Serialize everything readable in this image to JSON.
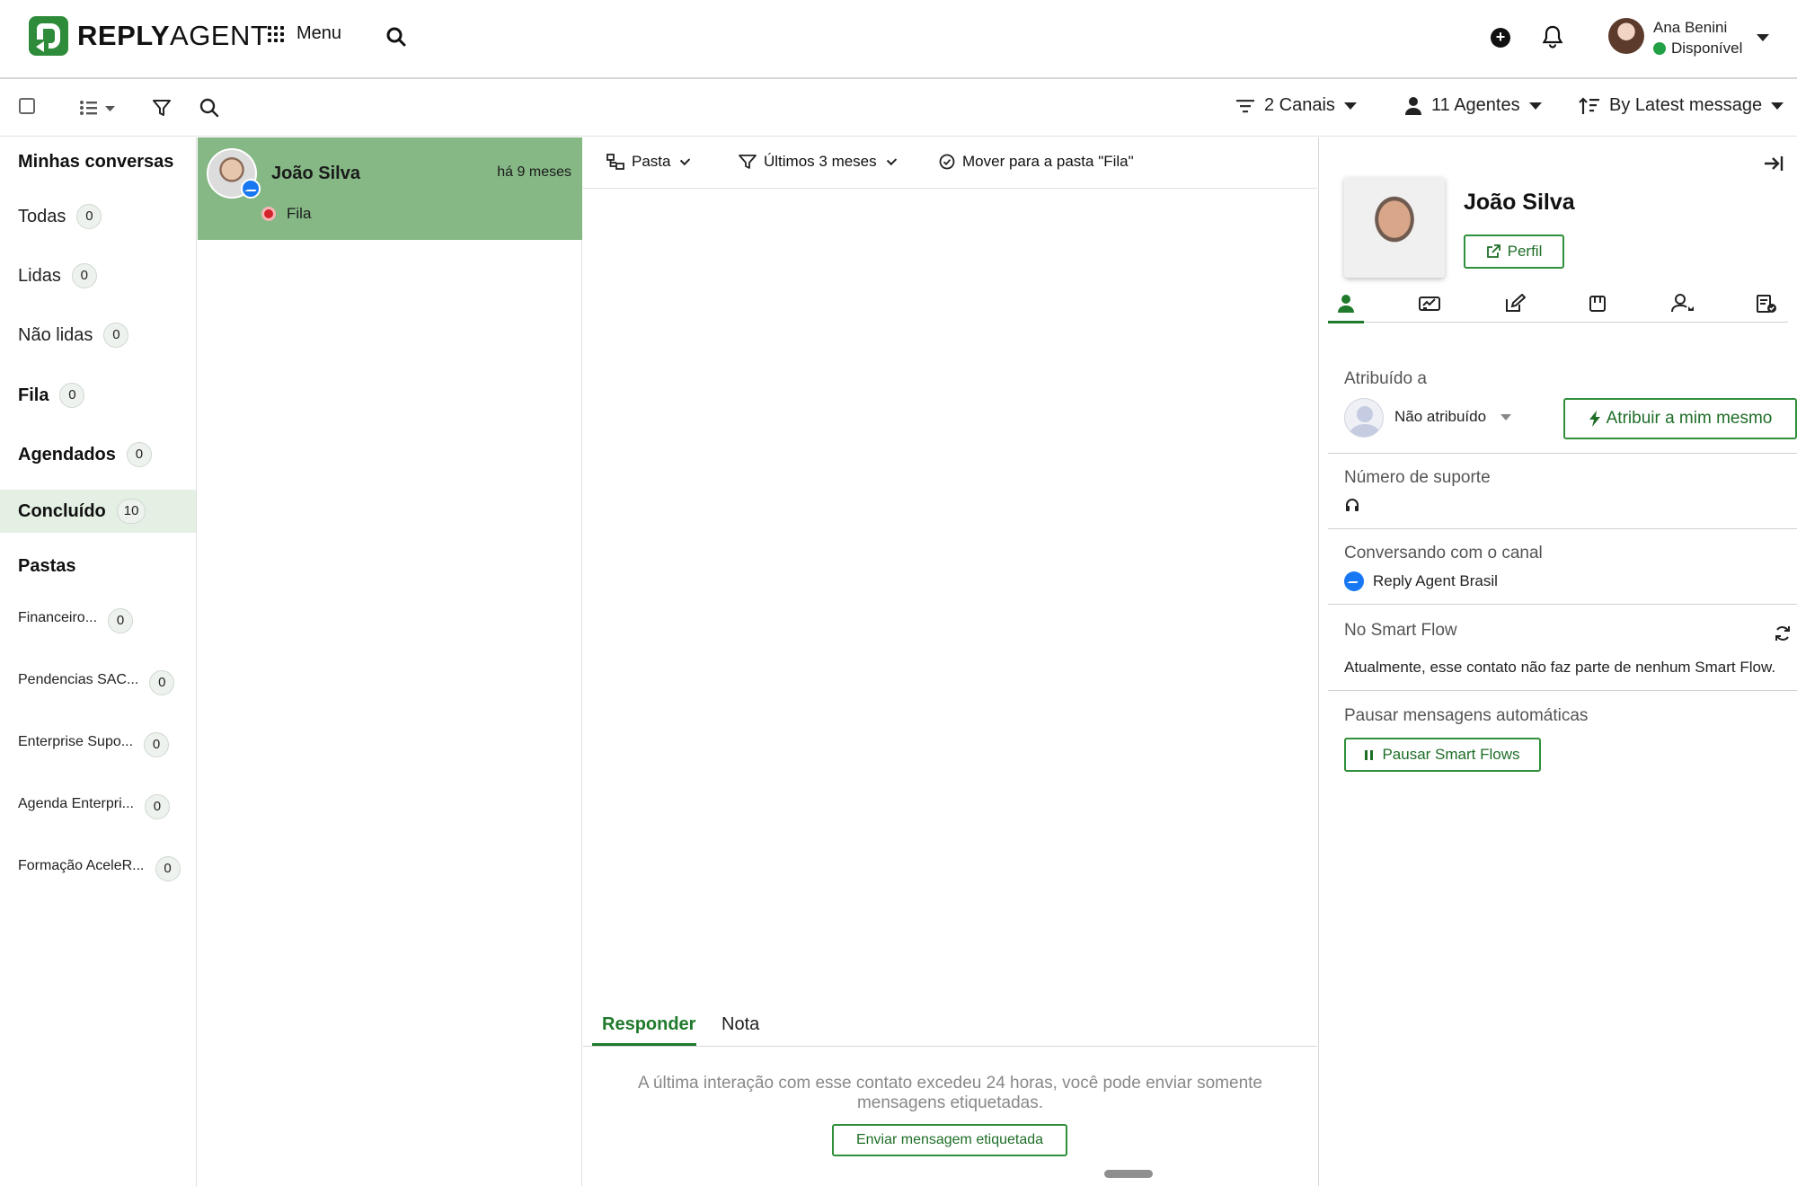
{
  "brand": {
    "name_bold": "REPLY",
    "name_light": "AGENT"
  },
  "header": {
    "menu_label": "Menu",
    "user_name": "Ana Benini",
    "user_status": "Disponível"
  },
  "toolbar": {
    "channels": "2 Canais",
    "agents": "11 Agentes",
    "sort": "By Latest message"
  },
  "nav": {
    "my_conversations": "Minhas conversas",
    "items": [
      {
        "label": "Todas",
        "count": "0"
      },
      {
        "label": "Lidas",
        "count": "0"
      },
      {
        "label": "Não lidas",
        "count": "0"
      },
      {
        "label": "Fila",
        "count": "0"
      },
      {
        "label": "Agendados",
        "count": "0"
      },
      {
        "label": "Concluído",
        "count": "10"
      }
    ],
    "folders_title": "Pastas",
    "folders": [
      {
        "label": "Financeiro...",
        "count": "0"
      },
      {
        "label": "Pendencias SAC...",
        "count": "0"
      },
      {
        "label": "Enterprise Supo...",
        "count": "0"
      },
      {
        "label": "Agenda Enterpri...",
        "count": "0"
      },
      {
        "label": "Formação AceleR...",
        "count": "0"
      }
    ]
  },
  "conversation": {
    "name": "João Silva",
    "time": "há 9 meses",
    "status": "Fila"
  },
  "chat": {
    "folder_label": "Pasta",
    "period_label": "Últimos 3 meses",
    "move_label": "Mover para a pasta \"Fila\"",
    "tab_reply": "Responder",
    "tab_note": "Nota",
    "notice": "A última interação com esse contato excedeu 24 horas, você pode enviar somente mensagens etiquetadas.",
    "tagged_button": "Enviar mensagem etiquetada"
  },
  "contact": {
    "name": "João Silva",
    "profile_button": "Perfil",
    "assigned_to_label": "Atribuído a",
    "unassigned": "Não atribuído",
    "assign_me_button": "Atribuir a mim mesmo",
    "support_number_label": "Número de suporte",
    "channel_label": "Conversando com o canal",
    "channel_name": "Reply Agent Brasil",
    "smart_flow_label": "No Smart Flow",
    "smart_flow_text": "Atualmente, esse contato não faz parte de nenhum Smart Flow.",
    "pause_label": "Pausar mensagens automáticas",
    "pause_button": "Pausar Smart Flows"
  },
  "colors": {
    "brand_green": "#2e8b3a",
    "selected_conversation": "#86b886",
    "active_nav": "#e4f0e4",
    "messenger_blue": "#1877f2",
    "status_red": "#d2232a"
  }
}
